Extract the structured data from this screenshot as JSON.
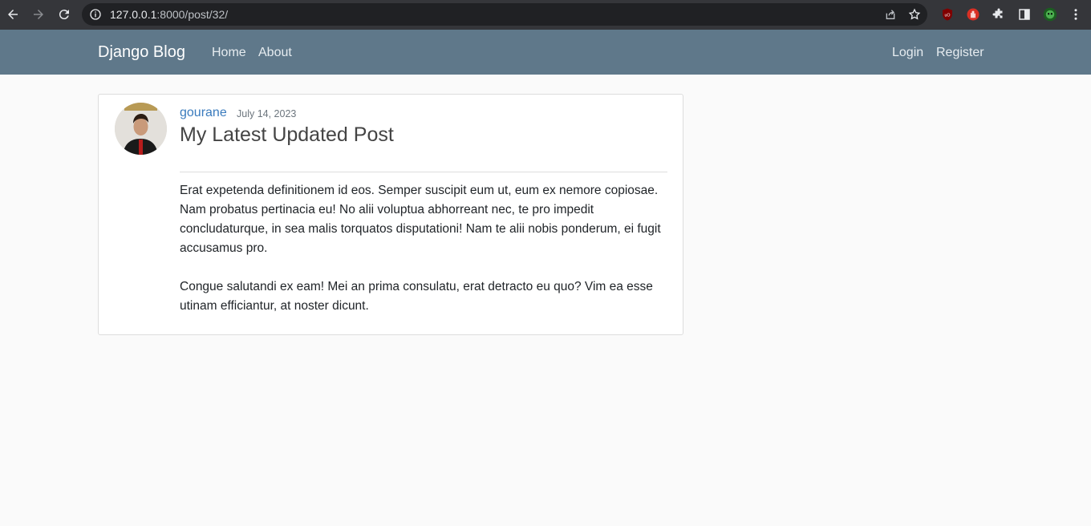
{
  "browser": {
    "url_host": "127.0.0.1",
    "url_rest": ":8000/post/32/",
    "icons": [
      "back-arrow-icon",
      "forward-arrow-icon",
      "reload-icon",
      "info-icon",
      "share-icon",
      "star-icon",
      "ublock-icon",
      "hand-extension-icon",
      "puzzle-icon",
      "side-panel-icon",
      "profile-icon",
      "kebab-menu-icon"
    ]
  },
  "navbar": {
    "brand": "Django Blog",
    "home": "Home",
    "about": "About",
    "login": "Login",
    "register": "Register",
    "bg_color": "#5f788a"
  },
  "post": {
    "author": "gourane",
    "date": "July 14, 2023",
    "title": "My Latest Updated Post",
    "paragraphs": [
      "Erat expetenda definitionem id eos. Semper suscipit eum ut, eum ex nemore copiosae. Nam probatus pertinacia eu! No alii voluptua abhorreant nec, te pro impedit concludaturque, in sea malis torquatos disputationi! Nam te alii nobis ponderum, ei fugit accusamus pro.",
      "Congue salutandi ex eam! Mei an prima consulatu, erat detracto eu quo? Vim ea esse utinam efficiantur, at noster dicunt."
    ]
  }
}
